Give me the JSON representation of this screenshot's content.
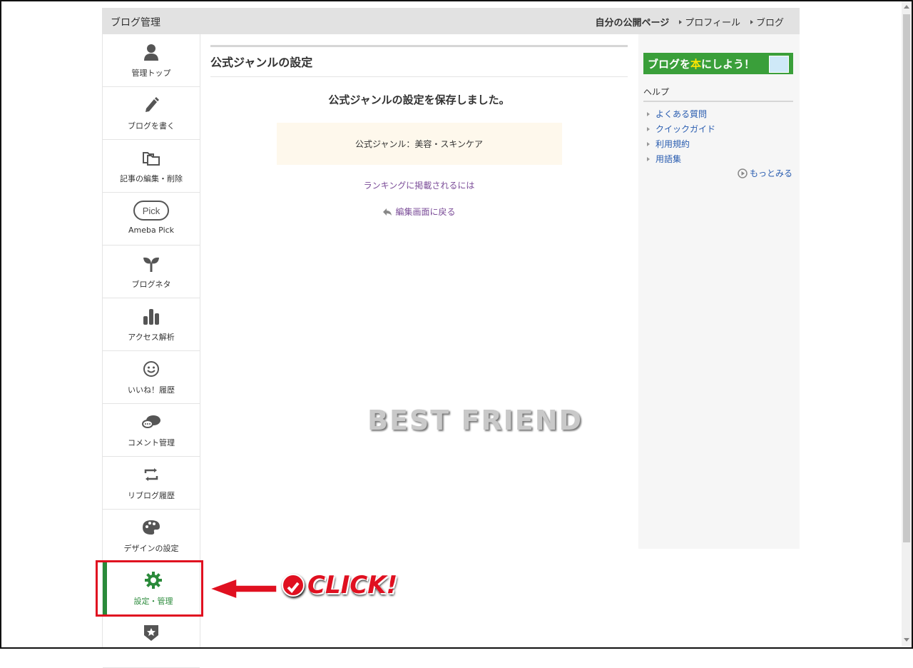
{
  "header": {
    "title": "ブログ管理",
    "nav": [
      "自分の公開ページ",
      "プロフィール",
      "ブログ"
    ]
  },
  "sidebar": {
    "items": [
      {
        "label": "管理トップ",
        "icon": "person-icon"
      },
      {
        "label": "ブログを書く",
        "icon": "pencil-icon"
      },
      {
        "label": "記事の編集・削除",
        "icon": "folders-icon"
      },
      {
        "label": "Ameba Pick",
        "icon": "pick-icon",
        "icon_text": "Pick"
      },
      {
        "label": "ブログネタ",
        "icon": "sprout-icon"
      },
      {
        "label": "アクセス解析",
        "icon": "bar-chart-icon"
      },
      {
        "label": "いいね！履歴",
        "icon": "smiley-icon"
      },
      {
        "label": "コメント管理",
        "icon": "comment-icon"
      },
      {
        "label": "リブログ履歴",
        "icon": "reblog-icon"
      },
      {
        "label": "デザインの設定",
        "icon": "palette-icon"
      },
      {
        "label": "設定・管理",
        "icon": "gear-icon",
        "active": true
      },
      {
        "label": "",
        "icon": "star-shield-icon"
      }
    ]
  },
  "main": {
    "heading": "公式ジャンルの設定",
    "message": "公式ジャンルの設定を保存しました。",
    "genre": "公式ジャンル：美容・スキンケア",
    "ranking_link": "ランキングに掲載されるには",
    "back_link": "編集画面に戻る"
  },
  "right": {
    "banner_pre": "ブログを",
    "banner_hon": "本",
    "banner_post": "にしよう！",
    "help_title": "ヘルプ",
    "help_links": [
      "よくある質問",
      "クイックガイド",
      "利用規約",
      "用語集"
    ],
    "more": "もっとみる"
  },
  "overlay": {
    "watermark": "BEST FRIEND",
    "click_text": "CLICK!",
    "accent_color": "#e01020"
  }
}
